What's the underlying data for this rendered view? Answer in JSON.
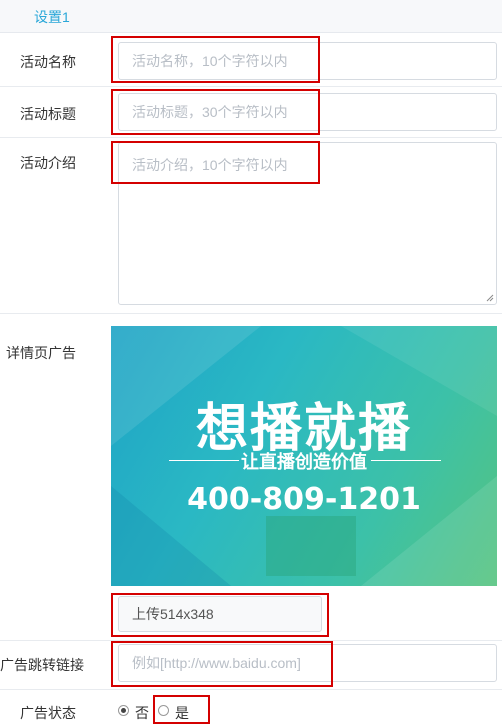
{
  "tab": {
    "label": "设置1"
  },
  "form": {
    "name": {
      "label": "活动名称",
      "placeholder": "活动名称，10个字符以内"
    },
    "title": {
      "label": "活动标题",
      "placeholder": "活动标题，30个字符以内"
    },
    "intro": {
      "label": "活动介绍",
      "placeholder": "活动介绍，10个字符以内"
    },
    "detail_ad": {
      "label": "详情页广告"
    },
    "upload": {
      "label": "上传514x348"
    },
    "ad_link": {
      "label": "广告跳转链接",
      "placeholder": "例如[http://www.baidu.com]"
    },
    "ad_status": {
      "label": "广告状态",
      "options": [
        {
          "label": "否",
          "checked": true
        },
        {
          "label": "是",
          "checked": false
        }
      ]
    }
  },
  "banner": {
    "headline": "想播就播",
    "tagline": "让直播创造价值",
    "phone": "400-809-1201"
  },
  "colors": {
    "accent": "#2aa7d8",
    "highlight": "#d40000"
  }
}
